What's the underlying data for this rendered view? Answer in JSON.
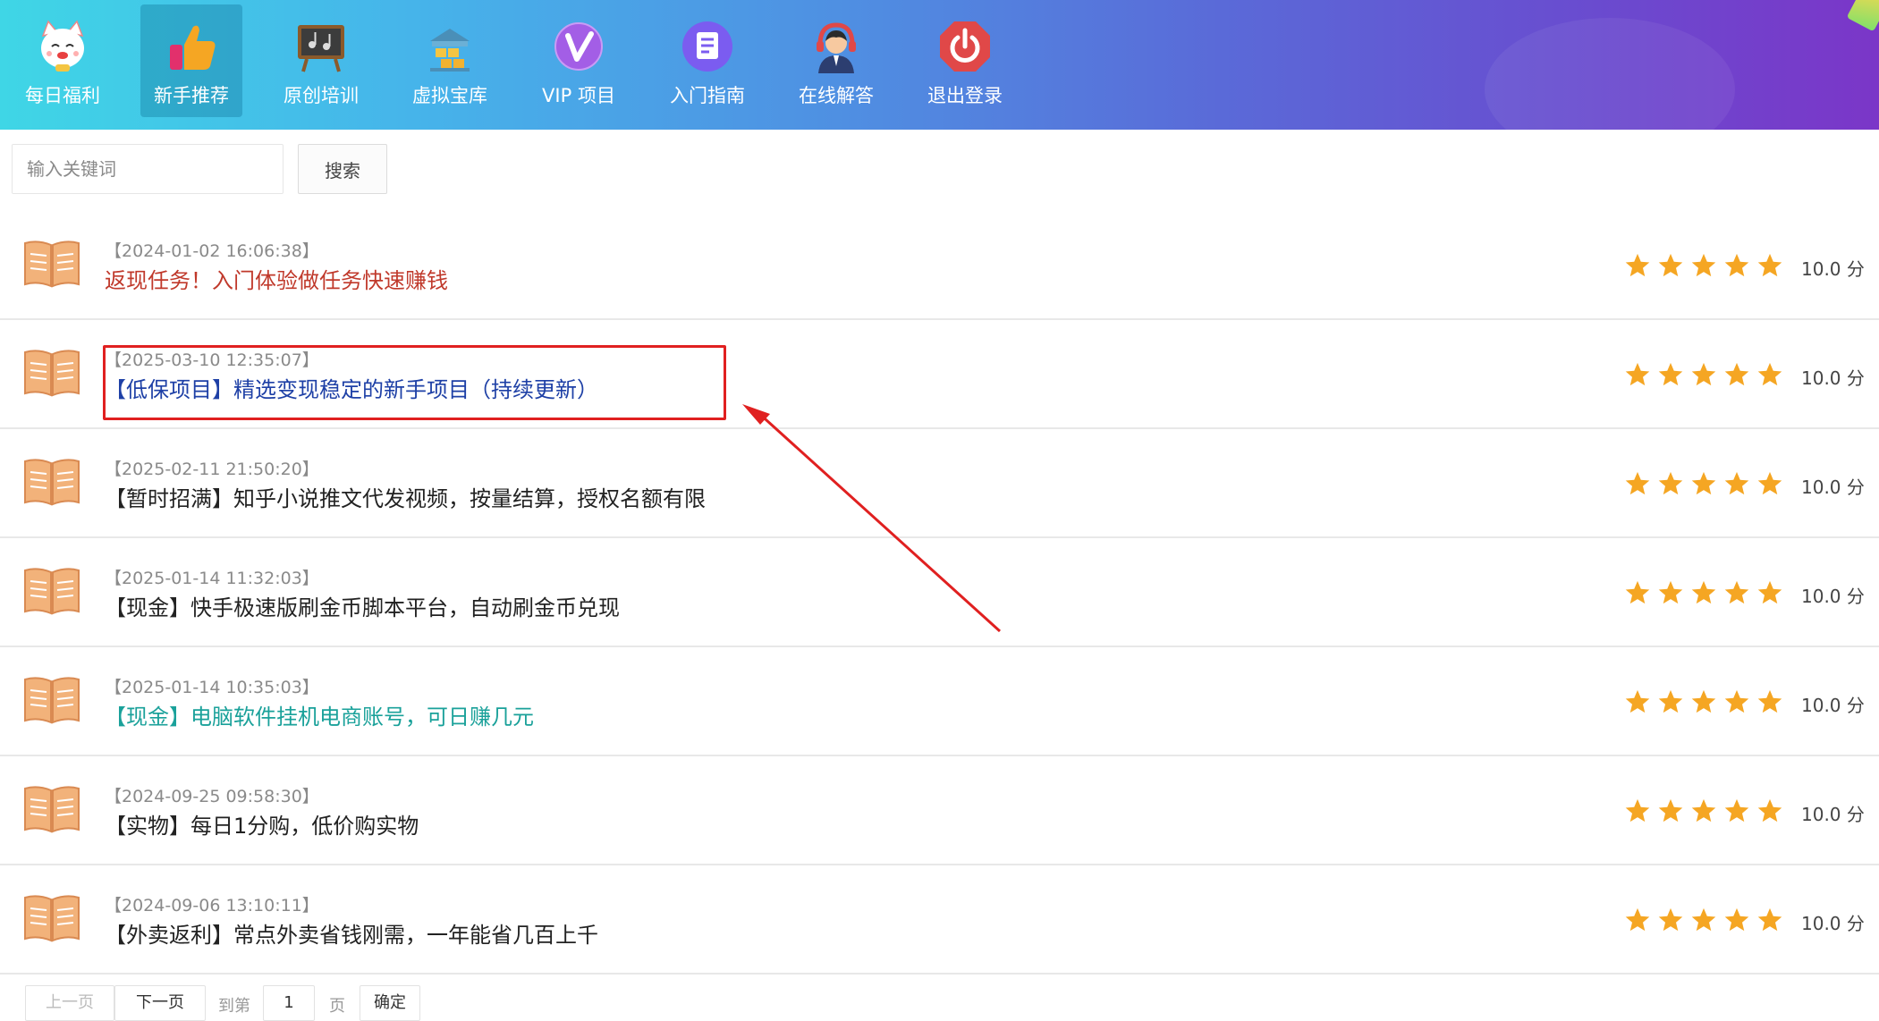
{
  "nav": {
    "items": [
      {
        "label": "每日福利",
        "icon": "lucky-cat-icon",
        "active": false
      },
      {
        "label": "新手推荐",
        "icon": "thumbs-up-icon",
        "active": true
      },
      {
        "label": "原创培训",
        "icon": "music-board-icon",
        "active": false
      },
      {
        "label": "虚拟宝库",
        "icon": "treasure-icon",
        "active": false
      },
      {
        "label": "VIP 项目",
        "icon": "vip-icon",
        "active": false
      },
      {
        "label": "入门指南",
        "icon": "document-icon",
        "active": false
      },
      {
        "label": "在线解答",
        "icon": "customer-service-icon",
        "active": false
      },
      {
        "label": "退出登录",
        "icon": "power-icon",
        "active": false
      }
    ]
  },
  "search": {
    "placeholder": "输入关键词",
    "button_label": "搜索"
  },
  "articles": [
    {
      "date": "【2024-01-02 16:06:38】",
      "title": "返现任务！入门体验做任务快速赚钱",
      "color": "#c0392b",
      "rating": 5,
      "score": "10.0 分"
    },
    {
      "date": "【2025-03-10 12:35:07】",
      "title": "【低保项目】精选变现稳定的新手项目（持续更新）",
      "color": "#1e40a6",
      "rating": 5,
      "score": "10.0 分"
    },
    {
      "date": "【2025-02-11 21:50:20】",
      "title": "【暂时招满】知乎小说推文代发视频，按量结算，授权名额有限",
      "color": "#222222",
      "rating": 5,
      "score": "10.0 分"
    },
    {
      "date": "【2025-01-14 11:32:03】",
      "title": "【现金】快手极速版刷金币脚本平台，自动刷金币兑现",
      "color": "#222222",
      "rating": 5,
      "score": "10.0 分"
    },
    {
      "date": "【2025-01-14 10:35:03】",
      "title": "【现金】电脑软件挂机电商账号，可日赚几元",
      "color": "#1aa19a",
      "rating": 5,
      "score": "10.0 分"
    },
    {
      "date": "【2024-09-25 09:58:30】",
      "title": "【实物】每日1分购，低价购实物",
      "color": "#222222",
      "rating": 5,
      "score": "10.0 分"
    },
    {
      "date": "【2024-09-06 13:10:11】",
      "title": "【外卖返利】常点外卖省钱刚需，一年能省几百上千",
      "color": "#222222",
      "rating": 5,
      "score": "10.0 分"
    }
  ],
  "pagination": {
    "prev": "上一页",
    "next": "下一页",
    "goto_prefix": "到第",
    "page_value": "1",
    "goto_suffix": "页",
    "confirm": "确定"
  },
  "colors": {
    "star": "#f5a623",
    "annotation": "#e02020",
    "book": "#f2b27a"
  }
}
